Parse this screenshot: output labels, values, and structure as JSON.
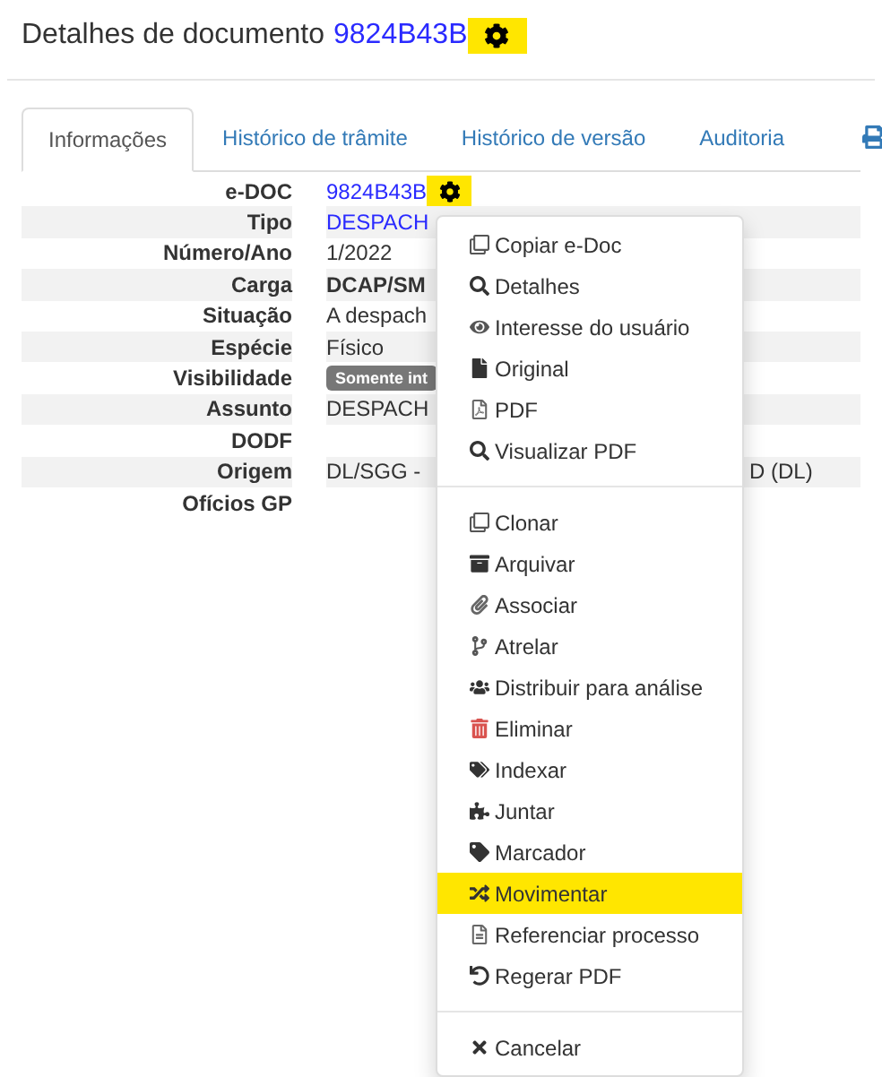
{
  "header": {
    "title": "Detalhes de documento",
    "doc_id": "9824B43B"
  },
  "tabs": [
    {
      "label": "Informações",
      "selected": true
    },
    {
      "label": "Histórico de trâmite",
      "selected": false
    },
    {
      "label": "Histórico de versão",
      "selected": false
    },
    {
      "label": "Auditoria",
      "selected": false
    }
  ],
  "details": [
    {
      "label": "e-DOC",
      "kind": "id",
      "value": "9824B43B"
    },
    {
      "label": "Tipo",
      "kind": "link",
      "value": "DESPACH"
    },
    {
      "label": "Número/Ano",
      "kind": "text",
      "value": "1/2022"
    },
    {
      "label": "Carga",
      "kind": "bold",
      "value": "DCAP/SM"
    },
    {
      "label": "Situação",
      "kind": "text",
      "value": "A despach"
    },
    {
      "label": "Espécie",
      "kind": "text",
      "value": "Físico"
    },
    {
      "label": "Visibilidade",
      "kind": "badge",
      "value": "Somente int"
    },
    {
      "label": "Assunto",
      "kind": "text",
      "value": "DESPACH"
    },
    {
      "label": "DODF",
      "kind": "empty"
    },
    {
      "label": "Origem",
      "kind": "split",
      "value": "DL/SGG -",
      "value_after_menu": "D (DL)"
    },
    {
      "label": "Ofícios GP",
      "kind": "empty"
    }
  ],
  "menu": {
    "groups": [
      [
        {
          "label": "Copiar e-Doc",
          "kind": "copy",
          "selected": false
        },
        {
          "label": "Detalhes",
          "kind": "search",
          "selected": false
        },
        {
          "label": "Interesse do usuário",
          "kind": "eye",
          "selected": false
        },
        {
          "label": "Original",
          "kind": "file",
          "selected": false
        },
        {
          "label": "PDF",
          "kind": "pdf",
          "selected": false
        },
        {
          "label": "Visualizar PDF",
          "kind": "search",
          "selected": false
        }
      ],
      [
        {
          "label": "Clonar",
          "kind": "copy",
          "selected": false
        },
        {
          "label": "Arquivar",
          "kind": "archive",
          "selected": false
        },
        {
          "label": "Associar",
          "kind": "paperclip",
          "selected": false
        },
        {
          "label": "Atrelar",
          "kind": "branch",
          "selected": false
        },
        {
          "label": "Distribuir para análise",
          "kind": "users",
          "selected": false
        },
        {
          "label": "Eliminar",
          "kind": "trash",
          "selected": false
        },
        {
          "label": "Indexar",
          "kind": "tags",
          "selected": false
        },
        {
          "label": "Juntar",
          "kind": "puzzle",
          "selected": false
        },
        {
          "label": "Marcador",
          "kind": "tag",
          "selected": false
        },
        {
          "label": "Movimentar",
          "kind": "shuffle",
          "selected": true
        },
        {
          "label": "Referenciar processo",
          "kind": "doc",
          "selected": false
        },
        {
          "label": "Regerar PDF",
          "kind": "undo",
          "selected": false
        }
      ],
      [
        {
          "label": "Cancelar",
          "kind": "close",
          "selected": false
        }
      ]
    ]
  }
}
